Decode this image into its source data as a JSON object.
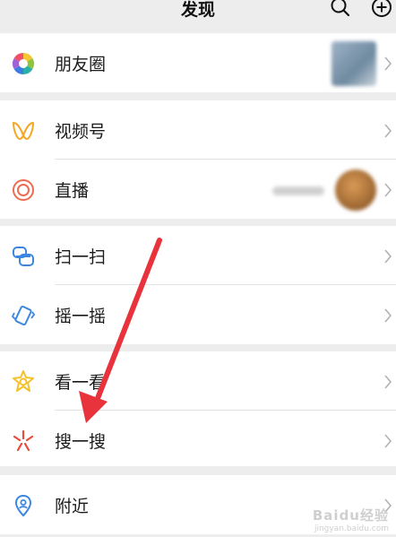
{
  "header": {
    "title": "发现",
    "search_icon": "search-icon",
    "add_icon": "plus-circle-icon"
  },
  "groups": [
    {
      "items": [
        {
          "label": "朋友圈",
          "icon": "moments-aperture-icon"
        }
      ]
    },
    {
      "items": [
        {
          "label": "视频号",
          "icon": "channels-butterfly-icon"
        },
        {
          "label": "直播",
          "icon": "live-ring-icon"
        }
      ]
    },
    {
      "items": [
        {
          "label": "扫一扫",
          "icon": "scan-icon"
        },
        {
          "label": "摇一摇",
          "icon": "shake-phone-icon"
        }
      ]
    },
    {
      "items": [
        {
          "label": "看一看",
          "icon": "top-stories-star-icon"
        },
        {
          "label": "搜一搜",
          "icon": "search-sparkle-icon"
        }
      ]
    },
    {
      "items": [
        {
          "label": "附近",
          "icon": "people-nearby-icon"
        }
      ]
    }
  ],
  "colors": {
    "background": "#ededed",
    "annotation_arrow": "#e8323c",
    "chevron": "#b2b2b2"
  },
  "watermark": {
    "main": "Baidu经验",
    "sub": "jingyan.baidu.com"
  }
}
